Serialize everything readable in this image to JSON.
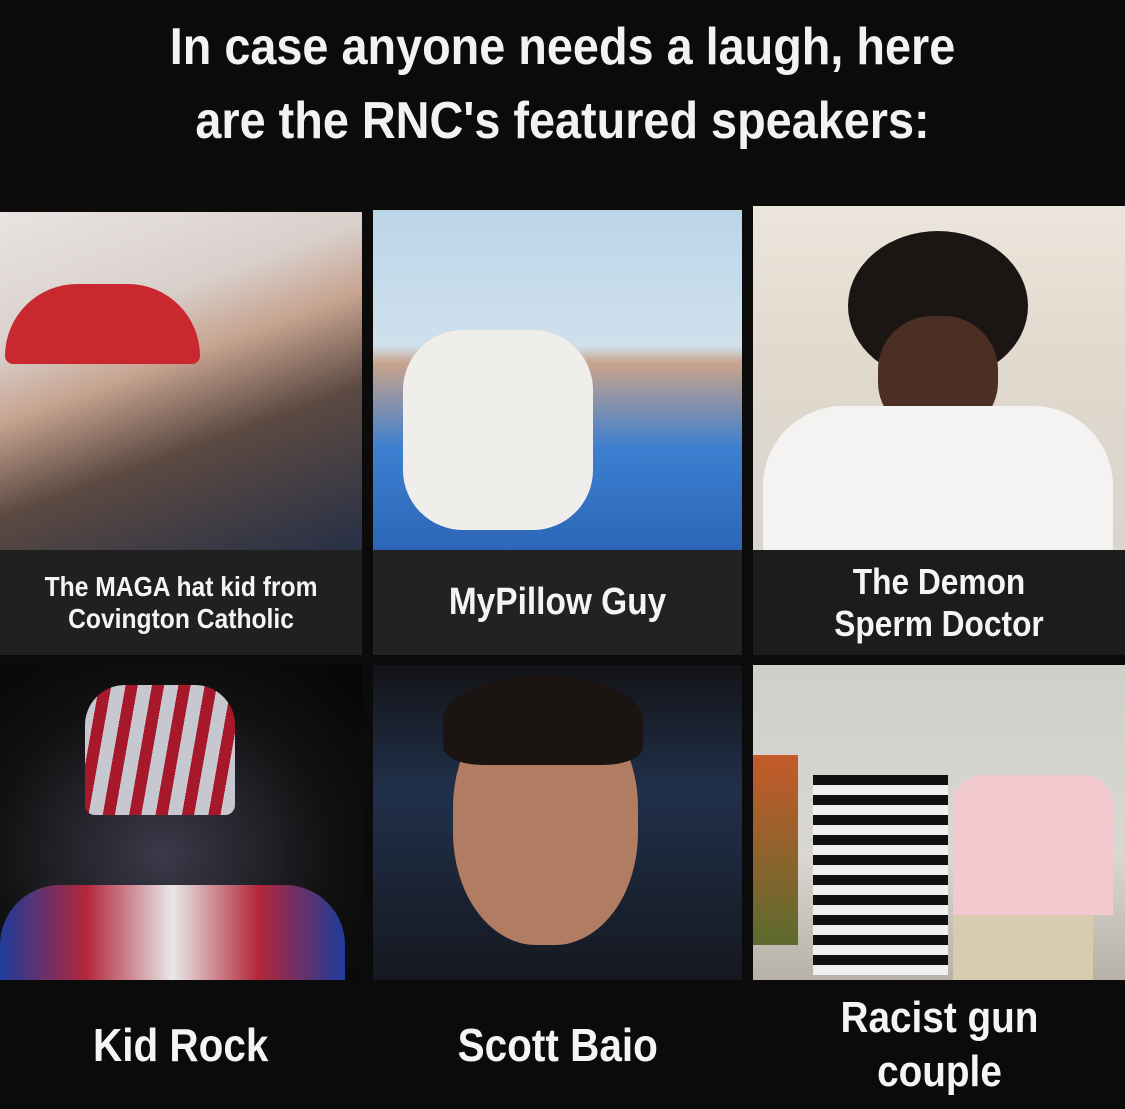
{
  "title": {
    "line1": "In case anyone needs a laugh, here",
    "line2": "are the RNC's featured speakers:"
  },
  "panels": [
    {
      "caption_line1": "The MAGA hat kid from",
      "caption_line2": "Covington Catholic"
    },
    {
      "caption_line1": "MyPillow Guy",
      "caption_line2": ""
    },
    {
      "caption_line1": "The Demon",
      "caption_line2": "Sperm Doctor"
    },
    {
      "caption_line1": "Kid Rock",
      "caption_line2": ""
    },
    {
      "caption_line1": "Scott Baio",
      "caption_line2": ""
    },
    {
      "caption_line1": "Racist gun",
      "caption_line2": "couple"
    }
  ],
  "colors": {
    "background": "#0b0b0b",
    "text": "#f2f2f2"
  }
}
